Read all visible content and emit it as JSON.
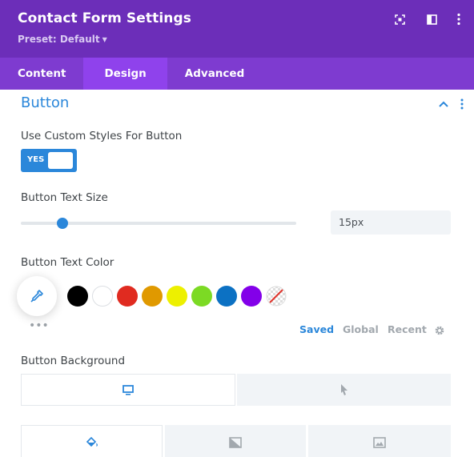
{
  "header": {
    "title": "Contact Form Settings",
    "preset_label": "Preset: Default",
    "bg_color": "#6c2eb9",
    "icons": [
      "fullscreen-icon",
      "split-view-icon",
      "more-options-icon"
    ]
  },
  "tabs": [
    {
      "label": "Content",
      "active": false
    },
    {
      "label": "Design",
      "active": true
    },
    {
      "label": "Advanced",
      "active": false
    }
  ],
  "section": {
    "title": "Button",
    "expanded": true
  },
  "custom_styles": {
    "label": "Use Custom Styles For Button",
    "toggle_label": "YES",
    "enabled": true
  },
  "text_size": {
    "label": "Button Text Size",
    "value": "15px",
    "slider_fraction": 0.15
  },
  "text_color": {
    "label": "Button Text Color",
    "swatches": [
      {
        "name": "black",
        "color": "#000000"
      },
      {
        "name": "white",
        "color": "#ffffff"
      },
      {
        "name": "red",
        "color": "#e02b20"
      },
      {
        "name": "orange",
        "color": "#e09900"
      },
      {
        "name": "yellow",
        "color": "#edf000"
      },
      {
        "name": "green",
        "color": "#7cda24"
      },
      {
        "name": "blue",
        "color": "#0c71c3"
      },
      {
        "name": "purple",
        "color": "#8300e9"
      },
      {
        "name": "none",
        "color": "transparent"
      }
    ],
    "palette_tabs": [
      {
        "label": "Saved",
        "active": true
      },
      {
        "label": "Global",
        "active": false
      },
      {
        "label": "Recent",
        "active": false
      }
    ],
    "more_label": "•••"
  },
  "background": {
    "label": "Button Background",
    "device_tabs": [
      "desktop-icon",
      "hover-cursor-icon"
    ],
    "type_tabs": [
      "paint-bucket-icon",
      "gradient-icon",
      "image-icon"
    ]
  },
  "colors": {
    "accent": "#2b87da",
    "tab_bar": "#7e3bd0",
    "tab_active": "#8f42ec"
  }
}
